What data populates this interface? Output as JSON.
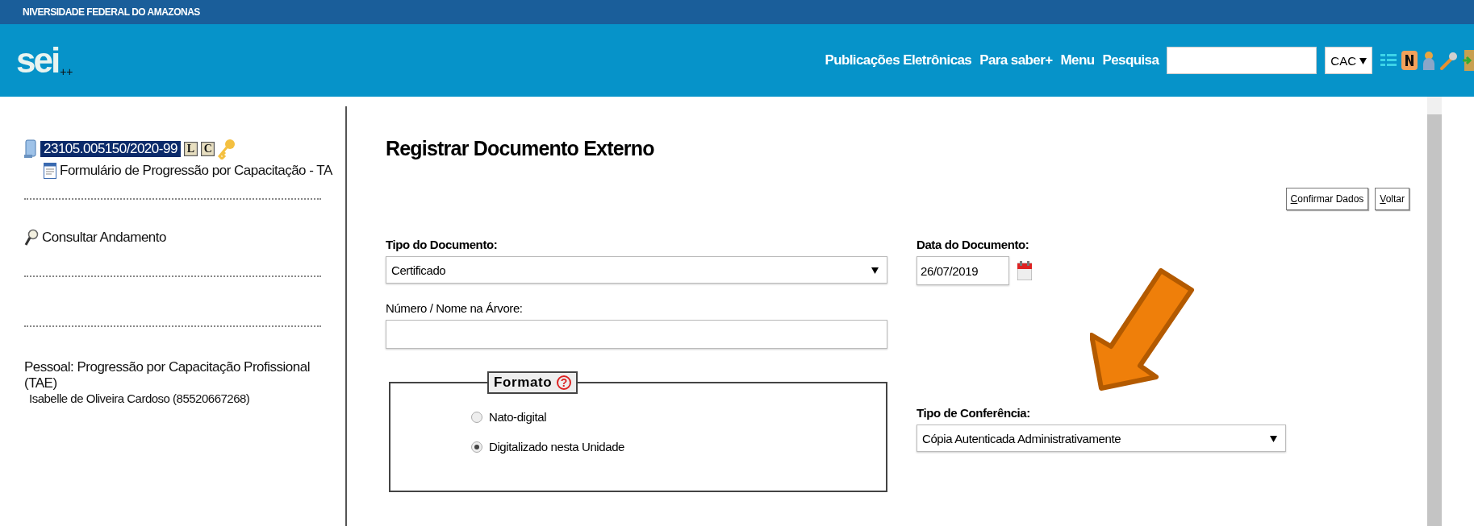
{
  "banner": {
    "institution": "NIVERSIDADE FEDERAL DO AMAZONAS"
  },
  "header": {
    "logo": "sei",
    "logo_suffix": "++",
    "nav_links": [
      "Publicações Eletrônicas",
      "Para saber+",
      "Menu",
      "Pesquisa"
    ],
    "unit_select": "CAC"
  },
  "process_tree": {
    "number": "23105.005150/2020-99",
    "selected": true,
    "badges": [
      "L",
      "C"
    ],
    "children": [
      {
        "label": "Formulário de Progressão por Capacitação - TA"
      }
    ]
  },
  "actions": [
    "Consultar Andamento"
  ],
  "process_type": "Pessoal: Progressão por Capacitação Profissional (TAE)",
  "interested": "Isabelle de Oliveira Cardoso (85520667268)",
  "form": {
    "title": "Registrar Documento Externo",
    "buttons": [
      "Confirmar Dados",
      "Voltar"
    ],
    "tipo_documento": {
      "label": "Tipo do Documento:",
      "value": "Certificado"
    },
    "data_documento": {
      "label": "Data do Documento:",
      "value": "26/07/2019"
    },
    "numero_nome": {
      "label": "Número / Nome na Árvore:"
    },
    "formato": {
      "legend": "Formato",
      "help": "?",
      "options": [
        {
          "label": "Nato-digital",
          "selected": false
        },
        {
          "label": "Digitalizado nesta Unidade",
          "selected": true
        }
      ]
    },
    "tipo_conferencia": {
      "label": "Tipo de Conferência:",
      "value": "Cópia Autenticada Administrativamente"
    }
  }
}
